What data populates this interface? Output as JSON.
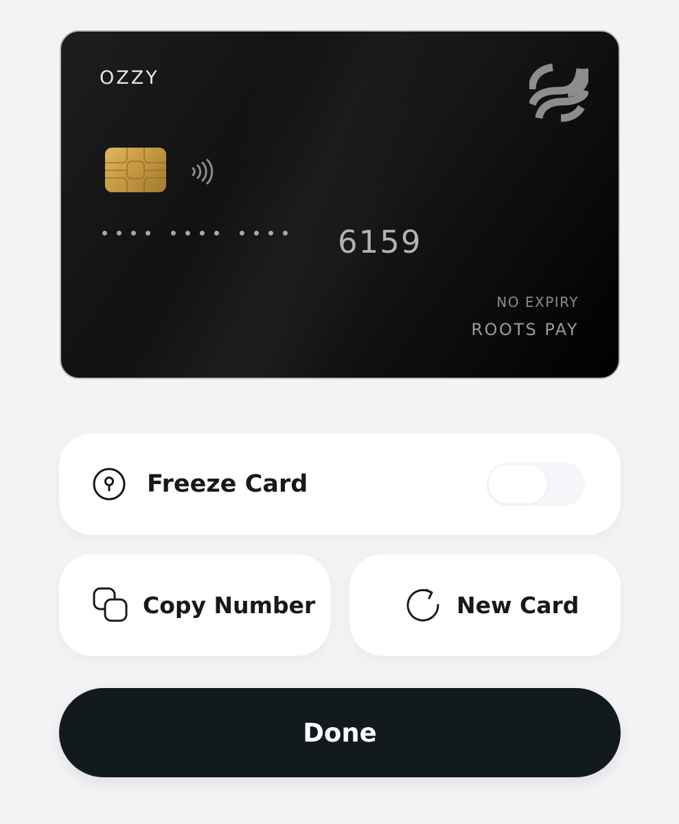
{
  "card": {
    "holder": "OZZY",
    "masked_groups": 3,
    "last4": "6159",
    "expiry": "NO EXPIRY",
    "brand": "ROOTS PAY",
    "logo_icon": "roots-pay-logo",
    "chip_icon": "emv-chip-icon",
    "contactless_icon": "contactless-icon"
  },
  "actions": {
    "freeze": {
      "label": "Freeze Card",
      "icon": "lock-icon",
      "toggle_on": false
    },
    "copy": {
      "label": "Copy Number",
      "icon": "copy-icon"
    },
    "new_card": {
      "label": "New Card",
      "icon": "refresh-icon"
    },
    "done": {
      "label": "Done"
    }
  },
  "colors": {
    "background": "#f3f3f6",
    "card": "#111112",
    "primary_button": "#131a1e",
    "chip_gold": "#c79a44"
  }
}
